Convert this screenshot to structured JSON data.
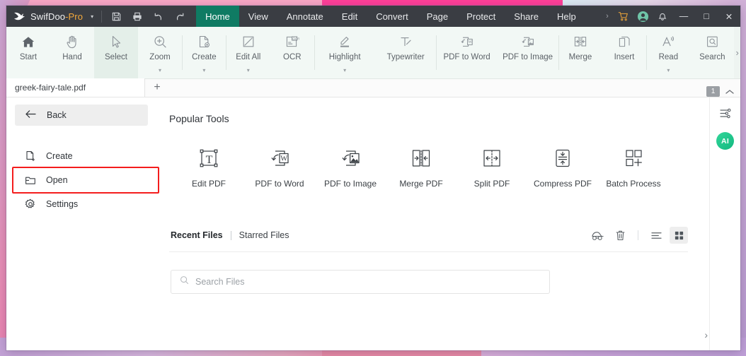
{
  "app": {
    "brand_name": "SwifDoo",
    "brand_suffix": "-Pro",
    "brand_caret": "▾"
  },
  "titlebar": {
    "quick_actions": [
      {
        "name": "save-icon",
        "label": "Save"
      },
      {
        "name": "print-icon",
        "label": "Print"
      },
      {
        "name": "undo-icon",
        "label": "Undo"
      },
      {
        "name": "redo-icon",
        "label": "Redo"
      }
    ],
    "menus": [
      {
        "label": "Home",
        "active": true
      },
      {
        "label": "View",
        "active": false
      },
      {
        "label": "Annotate",
        "active": false
      },
      {
        "label": "Edit",
        "active": false
      },
      {
        "label": "Convert",
        "active": false
      },
      {
        "label": "Page",
        "active": false
      },
      {
        "label": "Protect",
        "active": false
      },
      {
        "label": "Share",
        "active": false
      },
      {
        "label": "Help",
        "active": false
      }
    ],
    "more_chevron": "›",
    "right_icons": [
      {
        "name": "cart-icon",
        "label": "Store"
      },
      {
        "name": "account-icon",
        "label": "Account"
      },
      {
        "name": "bell-icon",
        "label": "Notifications"
      }
    ],
    "window_controls": {
      "minimize": "—",
      "maximize": "□",
      "close": "✕"
    }
  },
  "ribbon": {
    "groups": [
      {
        "items": [
          {
            "label": "Start",
            "icon": "home-icon",
            "dropdown": false,
            "selected": false
          },
          {
            "label": "Hand",
            "icon": "hand-icon",
            "dropdown": false,
            "selected": false
          },
          {
            "label": "Select",
            "icon": "cursor-icon",
            "dropdown": false,
            "selected": true
          },
          {
            "label": "Zoom",
            "icon": "zoom-in-icon",
            "dropdown": true,
            "selected": false
          }
        ]
      },
      {
        "items": [
          {
            "label": "Create",
            "icon": "create-file-icon",
            "dropdown": true,
            "selected": false
          }
        ]
      },
      {
        "items": [
          {
            "label": "Edit All",
            "icon": "edit-all-icon",
            "dropdown": true,
            "selected": false
          },
          {
            "label": "OCR",
            "icon": "ocr-icon",
            "dropdown": false,
            "selected": false
          }
        ]
      },
      {
        "items": [
          {
            "label": "Highlight",
            "icon": "highlight-icon",
            "dropdown": true,
            "selected": false
          },
          {
            "label": "Typewriter",
            "icon": "typewriter-icon",
            "dropdown": false,
            "selected": false
          }
        ]
      },
      {
        "items": [
          {
            "label": "PDF to Word",
            "icon": "pdf-to-word-icon",
            "dropdown": false,
            "selected": false
          },
          {
            "label": "PDF to Image",
            "icon": "pdf-to-image-icon",
            "dropdown": false,
            "selected": false
          }
        ]
      },
      {
        "items": [
          {
            "label": "Merge",
            "icon": "merge-icon",
            "dropdown": false,
            "selected": false
          },
          {
            "label": "Insert",
            "icon": "insert-page-icon",
            "dropdown": false,
            "selected": false
          }
        ]
      },
      {
        "items": [
          {
            "label": "Read",
            "icon": "read-aloud-icon",
            "dropdown": true,
            "selected": false
          },
          {
            "label": "Search",
            "icon": "search-doc-icon",
            "dropdown": false,
            "selected": false
          }
        ]
      }
    ],
    "overflow_chevron": "›"
  },
  "tabbar": {
    "tabs": [
      {
        "title": "greek-fairy-tale.pdf"
      }
    ],
    "new_tab": "+",
    "page_count": "1",
    "collapse_icon": "chevron-up-icon"
  },
  "leftnav": {
    "back_label": "Back",
    "items": [
      {
        "label": "Create",
        "icon": "new-document-icon",
        "highlighted": false
      },
      {
        "label": "Open",
        "icon": "folder-open-icon",
        "highlighted": true
      },
      {
        "label": "Settings",
        "icon": "gear-icon",
        "highlighted": false
      }
    ]
  },
  "main": {
    "popular_tools_title": "Popular Tools",
    "tools": [
      {
        "label": "Edit PDF",
        "icon": "edit-text-icon"
      },
      {
        "label": "PDF to Word",
        "icon": "pdf-to-word-icon"
      },
      {
        "label": "PDF to Image",
        "icon": "pdf-to-image-icon"
      },
      {
        "label": "Merge PDF",
        "icon": "merge-pdf-icon"
      },
      {
        "label": "Split PDF",
        "icon": "split-pdf-icon"
      },
      {
        "label": "Compress PDF",
        "icon": "compress-pdf-icon"
      },
      {
        "label": "Batch Process",
        "icon": "batch-process-icon"
      }
    ],
    "recent": {
      "tab_recent": "Recent Files",
      "tab_starred": "Starred Files",
      "actions": [
        {
          "name": "private-mode-icon",
          "selected": false
        },
        {
          "name": "delete-icon",
          "selected": false
        },
        {
          "name": "list-view-icon",
          "selected": false
        },
        {
          "name": "grid-view-icon",
          "selected": true
        }
      ]
    },
    "search": {
      "placeholder": "Search Files",
      "value": "",
      "icon": "search-icon"
    },
    "next_chevron": "›"
  },
  "rightrail": {
    "items": [
      {
        "name": "sliders-icon",
        "label": "Preferences"
      },
      {
        "name": "ai-assistant-badge",
        "label": "AI"
      }
    ]
  },
  "colors": {
    "titlebar_bg": "#3a3d43",
    "menu_active_bg": "#0f7b63",
    "ribbon_bg": "#f2f8f5",
    "highlight_border": "#f41d1d",
    "ai_green": "#11b87f",
    "brand_orange": "#f4a93c"
  }
}
